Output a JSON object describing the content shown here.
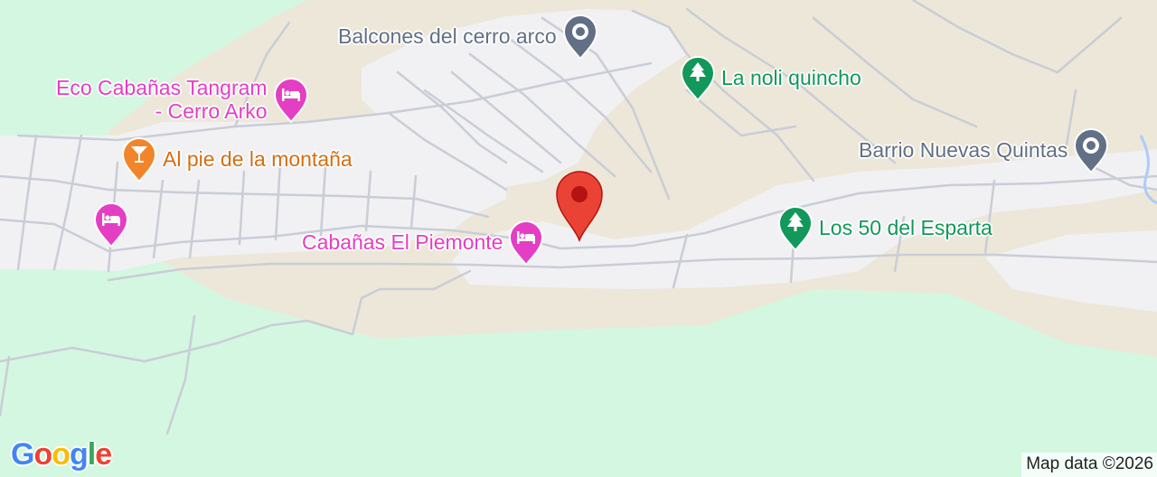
{
  "map": {
    "colors": {
      "park": "#d4f7e2",
      "terrain": "#ede7d9",
      "urban": "#f1f1f3",
      "road": "#c9cdd6",
      "hotel": "#e43ec5",
      "bar": "#f2852a",
      "park_poi": "#12985a",
      "neighborhood": "#627085",
      "marker": "#ea4335"
    },
    "pois": [
      {
        "name": "Balcones del cerro arco",
        "category": "neighborhood",
        "icon": "neighborhood-icon"
      },
      {
        "name_line1": "Eco Cabañas Tangram",
        "name_line2": "- Cerro Arko",
        "category": "hotel",
        "icon": "bed-icon"
      },
      {
        "name": "Al pie de la montaña",
        "category": "bar",
        "icon": "cocktail-icon"
      },
      {
        "name": "",
        "category": "hotel",
        "icon": "bed-icon"
      },
      {
        "name": "La noli quincho",
        "category": "park",
        "icon": "tree-icon"
      },
      {
        "name": "Barrio Nuevas Quintas",
        "category": "neighborhood",
        "icon": "neighborhood-icon"
      },
      {
        "name": "Cabañas El Piemonte",
        "category": "hotel",
        "icon": "bed-icon"
      },
      {
        "name": "Los 50 del Esparta",
        "category": "park",
        "icon": "tree-icon"
      }
    ],
    "selected_marker": {
      "icon": "location-pin-icon"
    },
    "logo": "Google",
    "attribution": "Map data ©2026"
  }
}
